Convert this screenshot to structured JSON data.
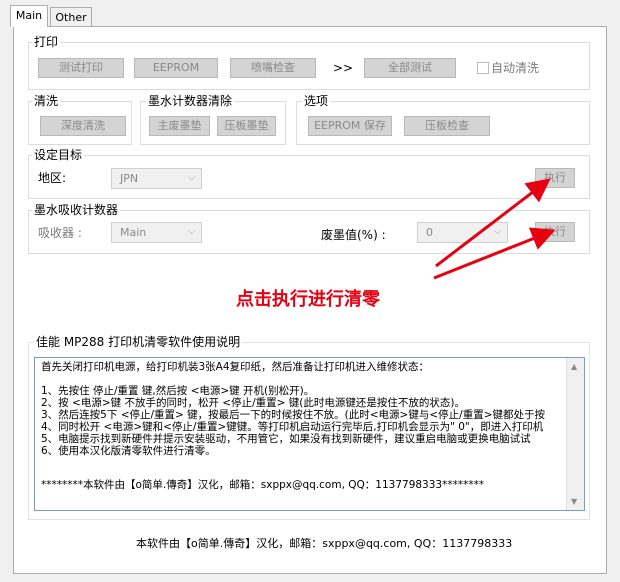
{
  "tabs": [
    {
      "label": "Main"
    },
    {
      "label": "Other"
    }
  ],
  "print_group": {
    "title": "打印",
    "test_print": "测试打印",
    "eeprom": "EEPROM",
    "nozzle_check": "喷嘴检查",
    "arrow": ">>",
    "all_test": "全部测试",
    "auto_clean": "自动清洗"
  },
  "clean_group": {
    "title": "清洗",
    "deep_clean": "深度清洗"
  },
  "ink_counter_group": {
    "title": "墨水计数器清除",
    "main_waste_pad": "主废墨垫",
    "platen_pad": "压板墨垫"
  },
  "options_group": {
    "title": "选项",
    "eeprom_save": "EEPROM 保存",
    "platen_check": "压板检查"
  },
  "target_group": {
    "title": "设定目标",
    "region_label": "地区:",
    "region_value": "JPN",
    "execute": "执行"
  },
  "absorber_group": {
    "title": "墨水吸收计数器",
    "absorber_label": "吸收器 :",
    "absorber_value": "Main",
    "waste_label": "废墨值(%) :",
    "waste_value": "0",
    "execute": "执行"
  },
  "annotation": "点击执行进行清零",
  "manual": {
    "title": "佳能 MP288 打印机清零软件使用说明",
    "lines": [
      "首先关闭打印机电源，给打印机装3张A4复印纸，然后准备让打印机进入维修状态：",
      "",
      "1、先按住 停止/重置 键,然后按 <电源>键  开机(别松开)。",
      "2、按 <电源>键 不放手的同时，松开 <停止/重置> 键(此时电源键还是按住不放的状态)。",
      "3、然后连按5下 <停止/重置> 键，按最后一下的时候按住不放。(此时<电源>键与<停止/重置>键都处于按",
      "4、同时松开 <电源>键和<停止/重置>键键。等打印机启动运行完毕后,打印机会显示为\" 0\"，即进入打印机",
      "5、电脑提示找到新硬件并提示安装驱动，不用管它，如果没有找到新硬件，建议重启电脑或更换电脑试试",
      "6、使用本汉化版清零软件进行清零。",
      "",
      "",
      "********本软件由【o简单.傳奇】汉化，邮箱：sxppx@qq.com, QQ：1137798333********"
    ]
  },
  "footer": "本软件由【o简单.傳奇】汉化，邮箱：sxppx@qq.com, QQ：1137798333",
  "colors": {
    "annotation": "#e60012",
    "textarea_border": "#7a9dc6"
  }
}
